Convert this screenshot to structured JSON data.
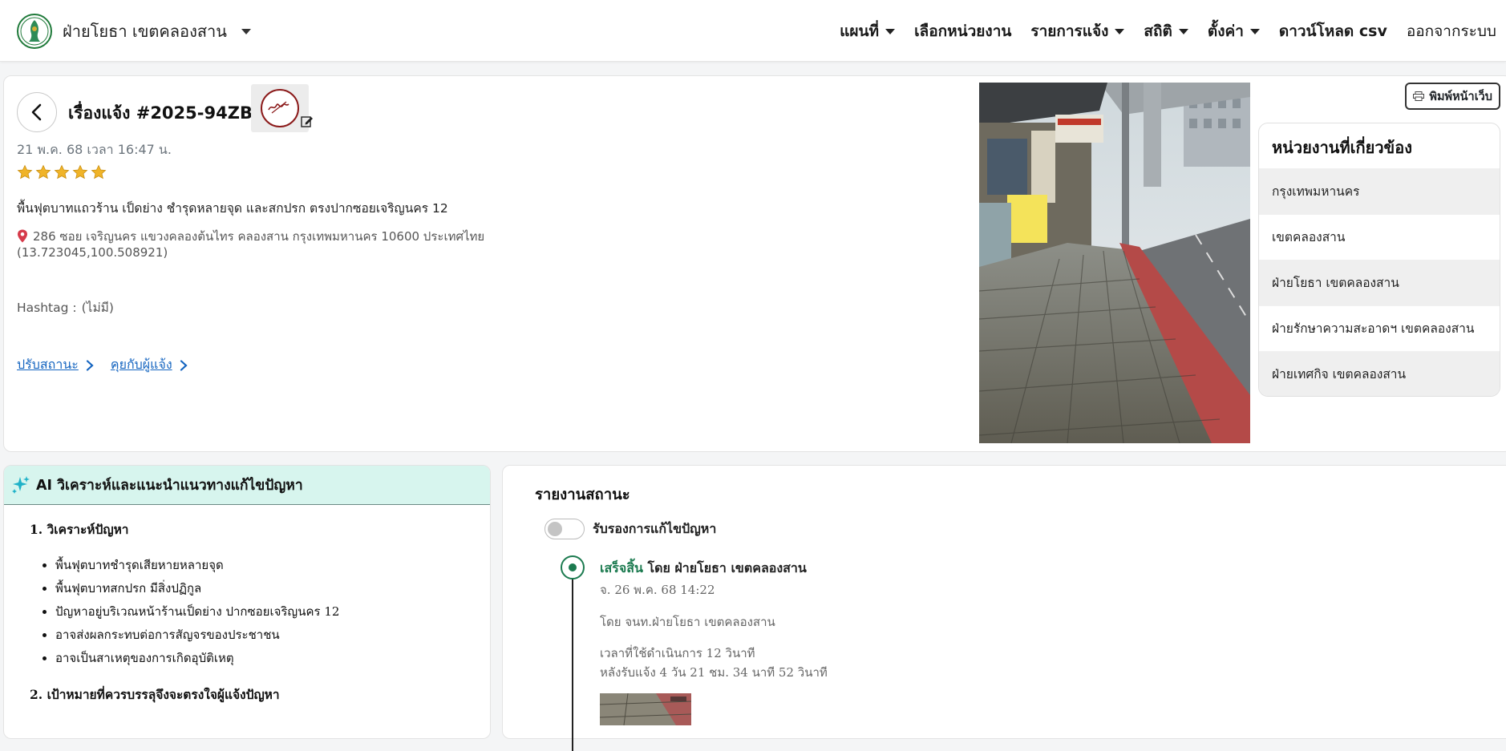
{
  "navbar": {
    "brand": "ฝ่ายโยธา เขตคลองสาน",
    "menu": [
      {
        "label": "แผนที่",
        "dropdown": true
      },
      {
        "label": "เลือกหน่วยงาน",
        "dropdown": false
      },
      {
        "label": "รายการแจ้ง",
        "dropdown": true
      },
      {
        "label": "สถิติ",
        "dropdown": true
      },
      {
        "label": "ตั้งค่า",
        "dropdown": true
      },
      {
        "label": "ดาวน์โหลด csv",
        "dropdown": false
      },
      {
        "label": "ออกจากระบบ",
        "dropdown": false
      }
    ]
  },
  "ticket": {
    "title": "เรื่องแจ้ง #2025-94ZBKD",
    "date": "21 พ.ค. 68 เวลา 16:47 น.",
    "rating": 5,
    "description": "พื้นฟุตบาทแถวร้าน เป็ดย่าง ชำรุดหลายจุด และสกปรก ตรงปากซอยเจริญนคร 12",
    "address": "286 ซอย เจริญนคร แขวงคลองต้นไทร คลองสาน กรุงเทพมหานคร 10600 ประเทศไทย",
    "coords": "(13.723045,100.508921)",
    "hashtag_label": "Hashtag :",
    "hashtag_value": "(ไม่มี)",
    "links": {
      "update_status": "ปรับสถานะ",
      "chat": "คุยกับผู้แจ้ง"
    }
  },
  "print_button": "พิมพ์หน้าเว็บ",
  "agencies": {
    "title": "หน่วยงานที่เกี่ยวข้อง",
    "items": [
      "กรุงเทพมหานคร",
      "เขตคลองสาน",
      "ฝ่ายโยธา เขตคลองสาน",
      "ฝ่ายรักษาความสะอาดฯ เขตคลองสาน",
      "ฝ่ายเทศกิจ เขตคลองสาน"
    ]
  },
  "ai": {
    "title": "AI วิเคราะห์และแนะนำแนวทางแก้ไขปัญหา",
    "section1": "1. วิเคราะห์ปัญหา",
    "points": [
      "พื้นฟุตบาทชำรุดเสียหายหลายจุด",
      "พื้นฟุตบาทสกปรก มีสิ่งปฏิกูล",
      "ปัญหาอยู่บริเวณหน้าร้านเป็ดย่าง ปากซอยเจริญนคร 12",
      "อาจส่งผลกระทบต่อการสัญจรของประชาชน",
      "อาจเป็นสาเหตุของการเกิดอุบัติเหตุ"
    ],
    "section2": "2. เป้าหมายที่ควรบรรลุจึงจะตรงใจผู้แจ้งปัญหา"
  },
  "status": {
    "title": "รายงานสถานะ",
    "toggle_label": "รับรองการแก้ไขปัญหา",
    "toggle_on": false,
    "entry": {
      "state": "เสร็จสิ้น",
      "by_org": "โดย ฝ่ายโยธา เขตคลองสาน",
      "date": "จ. 26 พ.ค. 68 14:22",
      "by_officer": "โดย จนท.ฝ่ายโยธา เขตคลองสาน",
      "duration": "เวลาที่ใช้ดำเนินการ 12 วินาที",
      "since_report": "หลังรับแจ้ง 4 วัน 21 ชม. 34 นาที 52 วินาที"
    }
  },
  "colors": {
    "accent_green": "#1b7a4f",
    "link_blue": "#1565c0",
    "ai_header_bg": "#d7f5ee",
    "star": "#f0b429"
  }
}
